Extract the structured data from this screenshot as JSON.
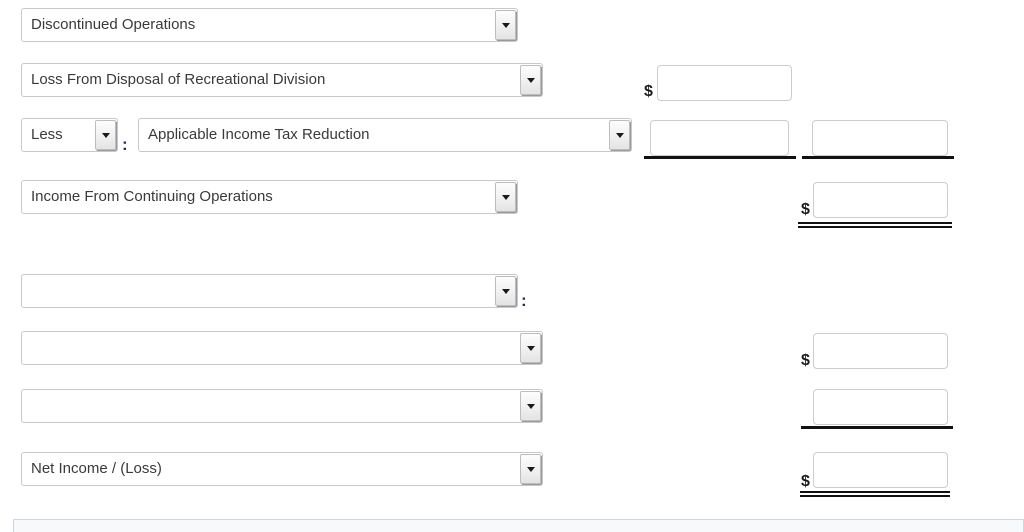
{
  "form": {
    "rows": [
      {
        "id": "discontinued-operations",
        "select_label": "Discontinued Operations",
        "has_colon": false,
        "prefix_select": null,
        "dollar": null,
        "amount_fields": 0
      },
      {
        "id": "loss-from-disposal",
        "select_label": "Loss From Disposal of Recreational Division",
        "has_colon": false,
        "prefix_select": null,
        "dollar": "$",
        "amount_fields": 1
      },
      {
        "id": "applicable-income-tax-reduction",
        "select_label": "Applicable Income Tax Reduction",
        "has_colon": true,
        "prefix_select": "Less",
        "dollar": null,
        "amount_fields": 2
      },
      {
        "id": "income-from-continuing-operations",
        "select_label": "Income From Continuing Operations",
        "has_colon": false,
        "prefix_select": null,
        "dollar": "$",
        "amount_fields": 1
      },
      {
        "id": "blank-row-1",
        "select_label": "",
        "has_colon": true,
        "prefix_select": null,
        "dollar": null,
        "amount_fields": 0
      },
      {
        "id": "blank-row-2",
        "select_label": "",
        "has_colon": false,
        "prefix_select": null,
        "dollar": "$",
        "amount_fields": 1
      },
      {
        "id": "blank-row-3",
        "select_label": "",
        "has_colon": false,
        "prefix_select": null,
        "dollar": null,
        "amount_fields": 1
      },
      {
        "id": "net-income-loss",
        "select_label": "Net Income / (Loss)",
        "has_colon": false,
        "prefix_select": null,
        "dollar": "$",
        "amount_fields": 1
      }
    ],
    "input_value": "",
    "input_placeholder": "",
    "colon_text": ":",
    "dollar_symbol": "$"
  },
  "colors": {
    "select_border": "#c8c8c8",
    "input_border": "#cccccc",
    "rule": "#111111",
    "colon": "#2b2b55",
    "panel_bg": "#f7f9fb",
    "panel_border": "#ccd7e4",
    "text": "#3a3a3a"
  }
}
